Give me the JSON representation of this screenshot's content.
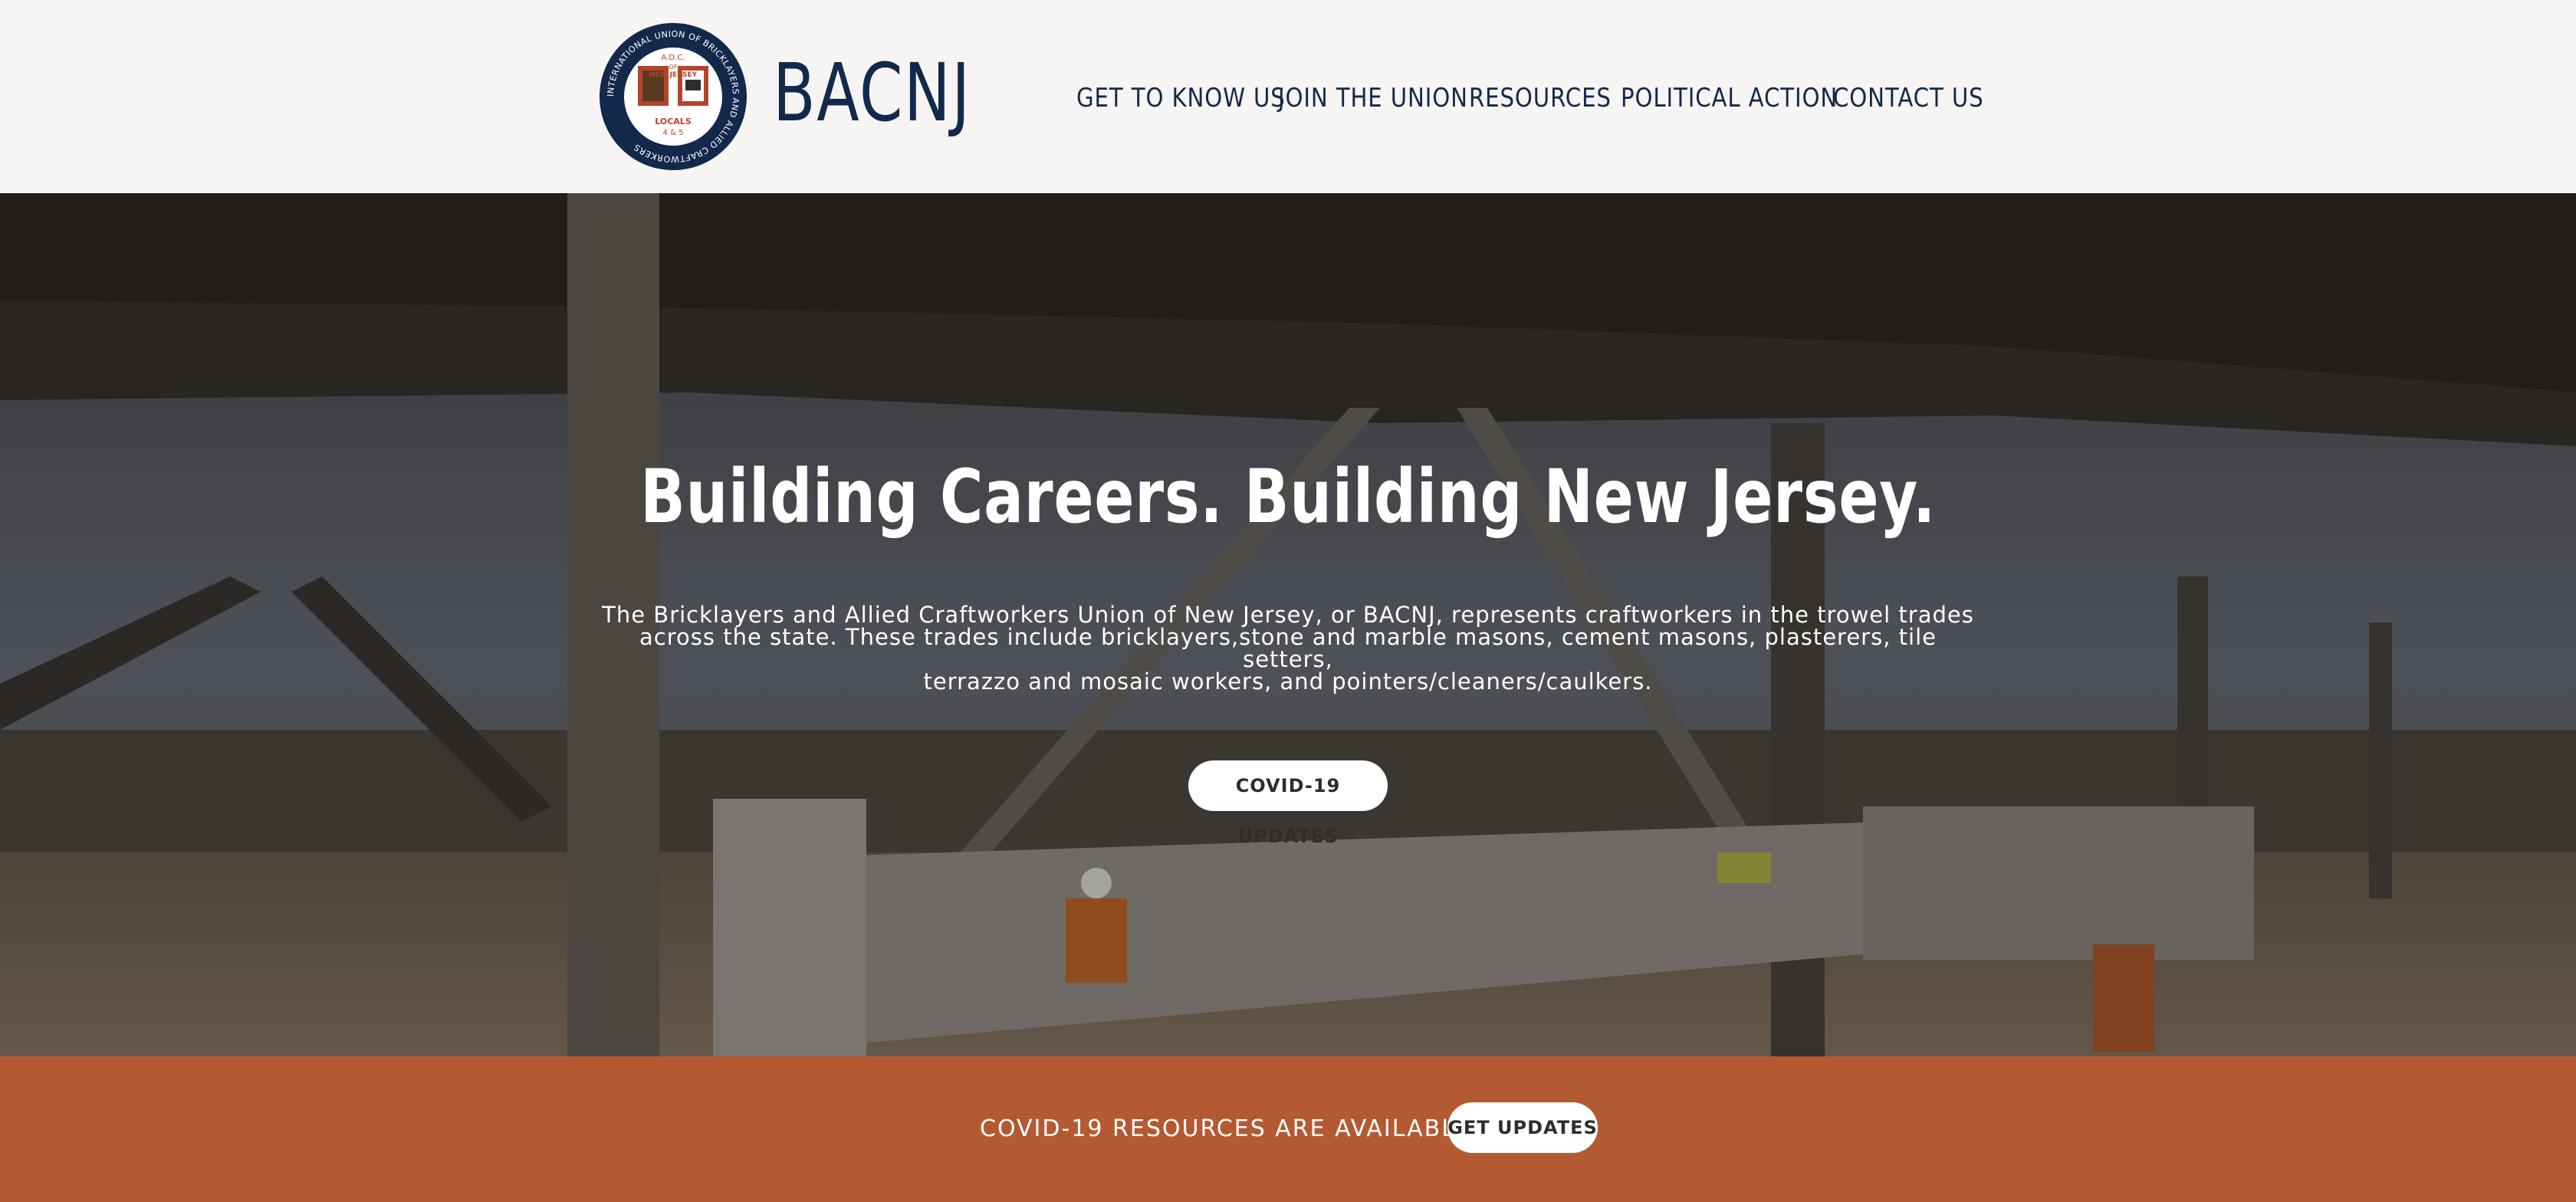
{
  "header": {
    "logo": {
      "ring_text": "INTERNATIONAL UNION OF BRICKLAYERS AND ALLIED CRAFTWORKERS",
      "center_top": "A.D.C.",
      "center_of": "OF",
      "center_state": "NEW JERSEY",
      "center_locals": "LOCALS",
      "center_numbers": "4 & 5"
    },
    "brand": "BACNJ",
    "nav": [
      {
        "label": "GET TO KNOW US"
      },
      {
        "label": "JOIN THE UNION"
      },
      {
        "label": "RESOURCES"
      },
      {
        "label": "POLITICAL ACTION"
      },
      {
        "label": "CONTACT US"
      }
    ]
  },
  "hero": {
    "title": "Building Careers. Building New Jersey.",
    "body_lines": [
      "The Bricklayers and Allied Craftworkers Union of New Jersey, or BACNJ, represents craftworkers in the trowel trades",
      "across the state. These trades include bricklayers,stone and marble masons, cement masons, plasterers, tile setters,",
      "terrazzo and mosaic workers, and pointers/cleaners/caulkers."
    ],
    "button_label": "COVID-19 UPDATES"
  },
  "banner": {
    "text": "COVID-19 RESOURCES ARE AVAILABLE",
    "button_label": "GET UPDATES"
  },
  "colors": {
    "navy": "#13294b",
    "header_bg": "#f6f5f3",
    "banner": "#b45a33",
    "logo_red": "#b5442b"
  }
}
